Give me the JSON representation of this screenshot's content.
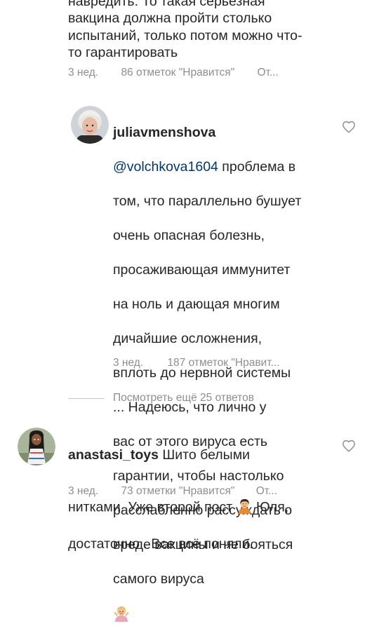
{
  "comment_prev": {
    "line_partial": "навредить. То такая серьезная",
    "line_1": "вакцина должна пройти столько",
    "line_2": "испытаний, только потом можно что-",
    "line_3": "то гарантировать",
    "time": "3 нед.",
    "likes": "86 отметок \"Нравится\"",
    "reply": "От..."
  },
  "reply_comment": {
    "username": "juliavmenshova",
    "mention": "@volchkova1604",
    "text_first": " проблема в",
    "lines": [
      "том, что параллельно бушует",
      "очень опасная болезнь,",
      "просаживающая иммунитет",
      "на ноль и дающая многим",
      "дичайшие осложнения,",
      "вплоть до нервной системы",
      "... Надеюсь, что лично у",
      "вас от этого вируса  есть",
      "гарантии, чтобы настолько",
      "расслабленно рассуждать  о",
      "вреде вакцины и не бояться",
      "самого вируса"
    ],
    "emoji": "person-shrugging-emoji",
    "time": "3 нед.",
    "likes": "187 отметок \"Нравит...",
    "heart_icon": "heart-outline-icon"
  },
  "view_replies": {
    "label": "Посмотреть ещё 25 ответов"
  },
  "comment_next": {
    "username": "anastasi_toys",
    "text_first": " Шито белыми",
    "line_1": "нитками. Уже второй пост ",
    "line_1_after": " Юля,",
    "line_2": "достаточно . Все всё поняли.",
    "emoji": "person-pouting-emoji",
    "time": "3 нед.",
    "likes": "73 отметки \"Нравится\"",
    "reply": "От...",
    "heart_icon": "heart-outline-icon"
  },
  "colors": {
    "text": "#262626",
    "secondary": "#8e8e8e",
    "mention": "#00376b",
    "divider": "#c7c7c7"
  }
}
